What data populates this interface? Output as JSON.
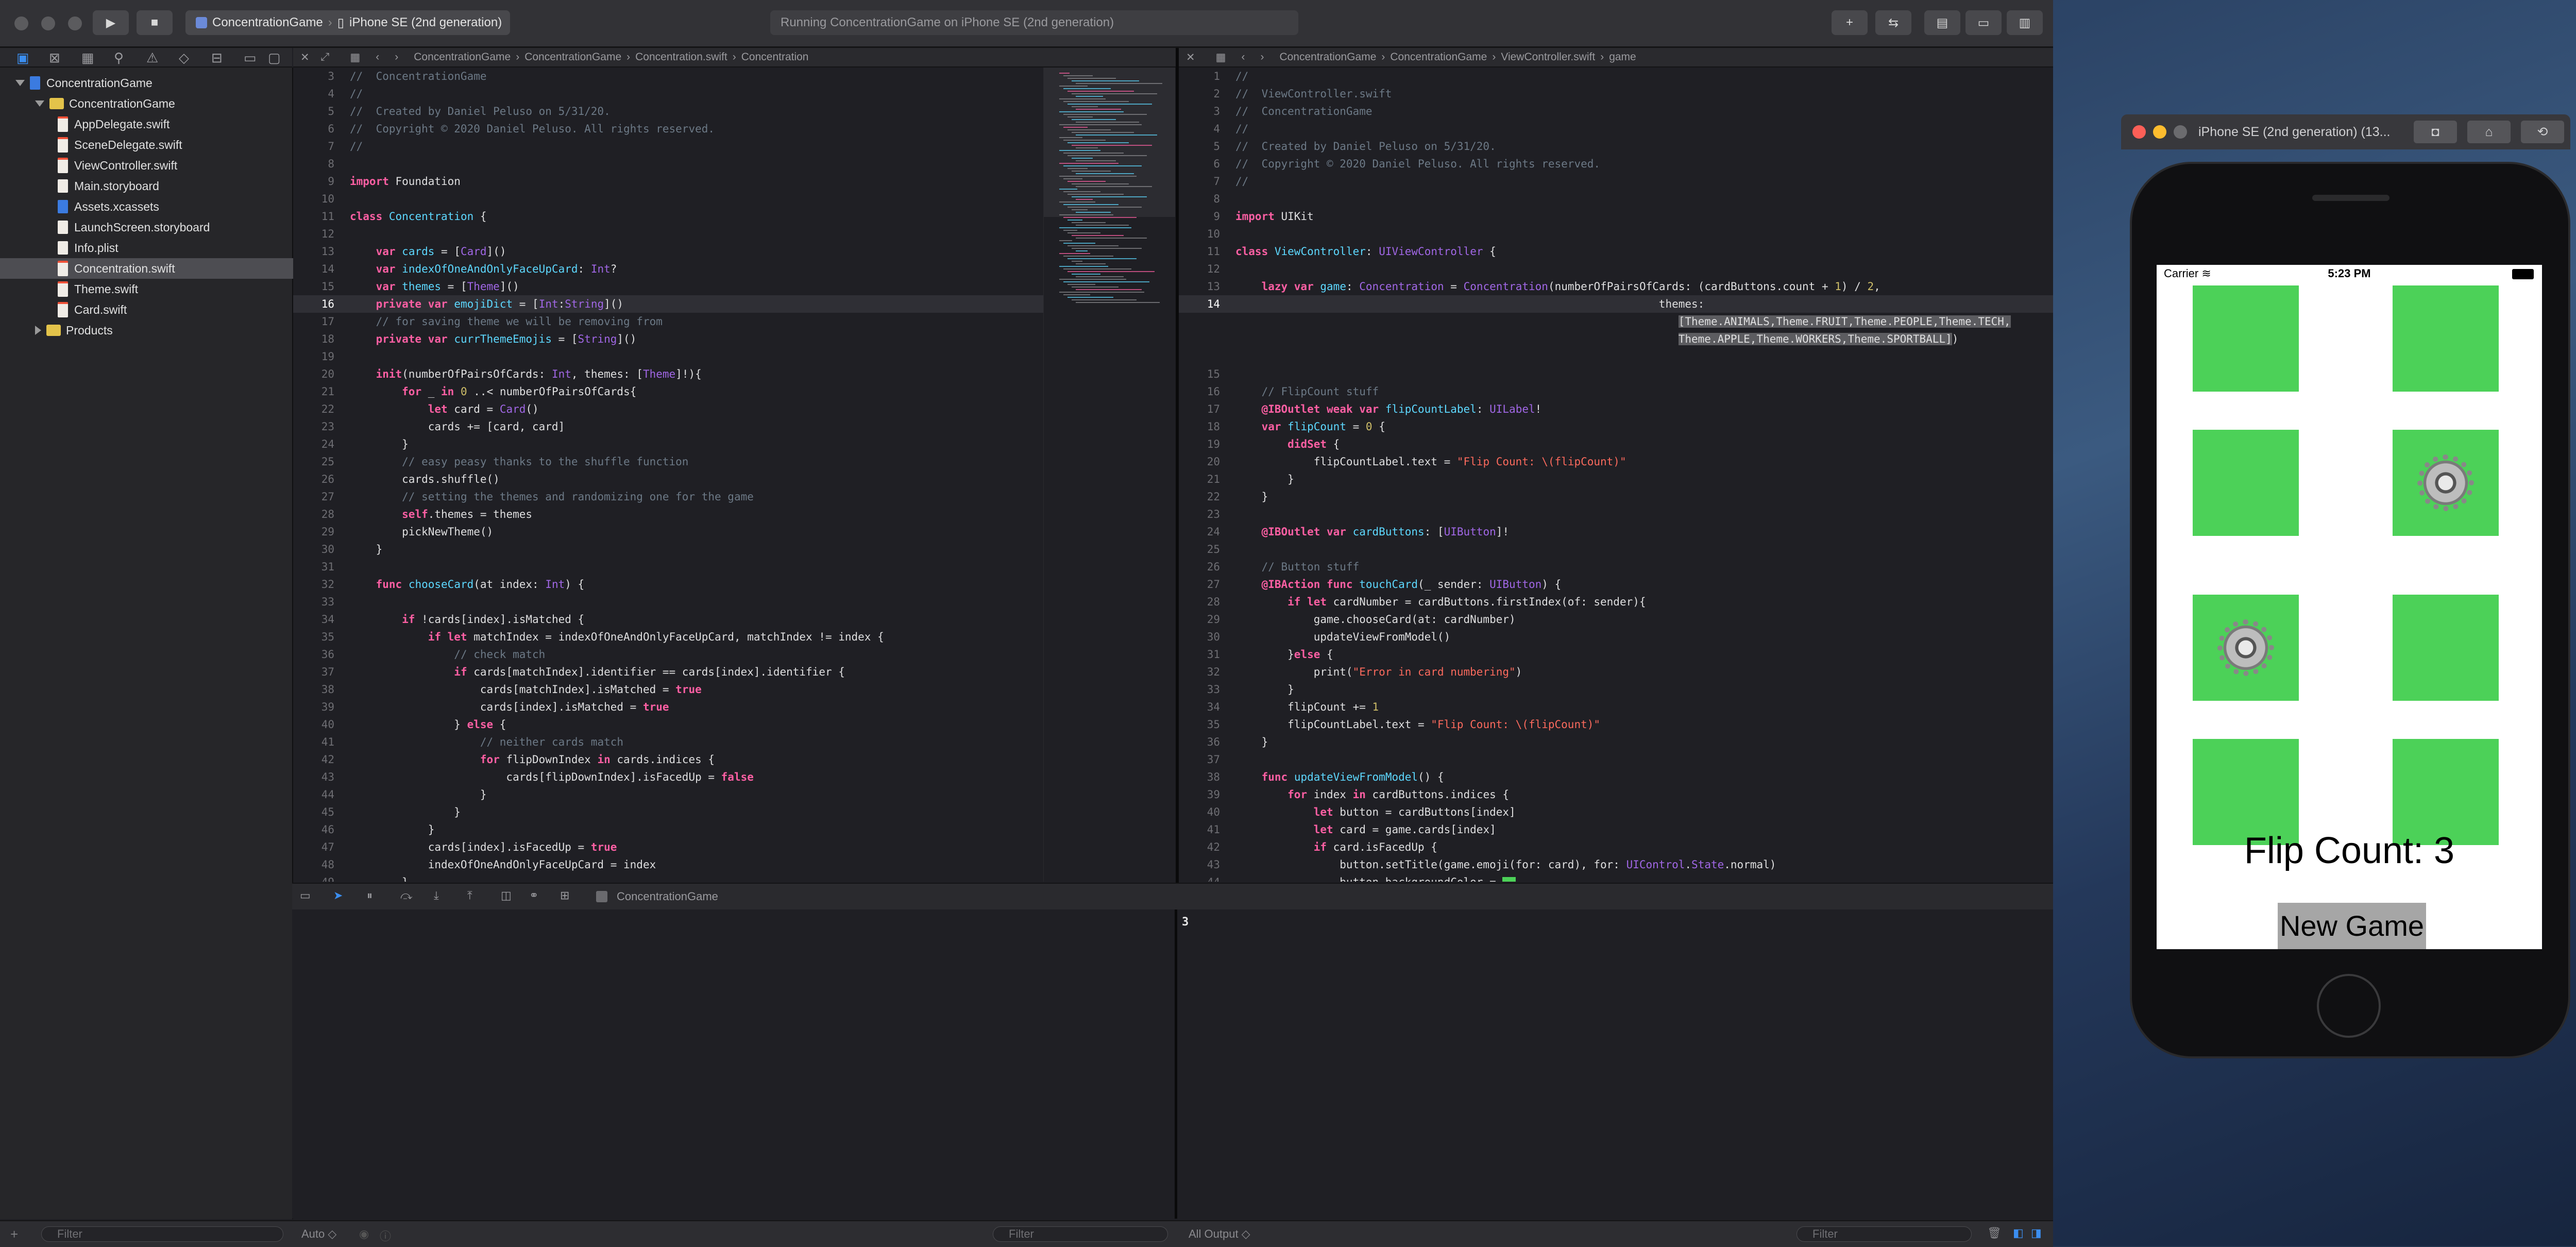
{
  "toolbar": {
    "scheme": "ConcentrationGame",
    "destination": "iPhone SE (2nd generation)",
    "activity": "Running ConcentrationGame on iPhone SE (2nd generation)"
  },
  "navigator": {
    "project": "ConcentrationGame",
    "group": "ConcentrationGame",
    "files": [
      "AppDelegate.swift",
      "SceneDelegate.swift",
      "ViewController.swift",
      "Main.storyboard",
      "Assets.xcassets",
      "LaunchScreen.storyboard",
      "Info.plist",
      "Concentration.swift",
      "Theme.swift",
      "Card.swift"
    ],
    "selected": "Concentration.swift",
    "products": "Products",
    "filter_placeholder": "Filter"
  },
  "left_editor": {
    "breadcrumb": [
      "ConcentrationGame",
      "ConcentrationGame",
      "Concentration.swift",
      "Concentration"
    ]
  },
  "right_editor": {
    "breadcrumb": [
      "ConcentrationGame",
      "ConcentrationGame",
      "ViewController.swift",
      "game"
    ]
  },
  "debug": {
    "target": "ConcentrationGame",
    "output_value": "3",
    "auto_label": "Auto ◇",
    "filter_placeholder": "Filter",
    "output_label": "All Output ◇"
  },
  "simulator": {
    "title": "iPhone SE (2nd generation) (13...",
    "carrier": "Carrier",
    "time": "5:23 PM",
    "flip_count_label": "Flip Count: 3",
    "new_game_button": "New Game",
    "card_color": "#4cd158",
    "cards": [
      {
        "face_up": false
      },
      {
        "face_up": false
      },
      {
        "face_up": false
      },
      {
        "face_up": true,
        "emoji": "gear-icon"
      },
      {
        "face_up": true,
        "emoji": "gear-icon"
      },
      {
        "face_up": false
      },
      {
        "face_up": false
      },
      {
        "face_up": false
      }
    ]
  }
}
